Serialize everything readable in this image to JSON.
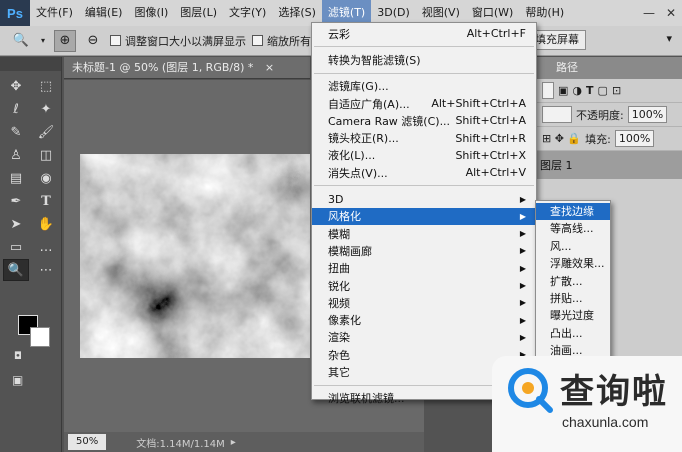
{
  "app": {
    "logo": "Ps"
  },
  "menubar": {
    "items": [
      "文件(F)",
      "编辑(E)",
      "图像(I)",
      "图层(L)",
      "文字(Y)",
      "选择(S)",
      "滤镜(T)",
      "3D(D)",
      "视图(V)",
      "窗口(W)",
      "帮助(H)"
    ],
    "active": "滤镜(T)"
  },
  "options": {
    "resize_windows": "调整窗口大小以满屏显示",
    "zoom_all": "缩放所有",
    "fill_screen": "填充屏幕"
  },
  "document": {
    "tab_title": "未标题-1 @ 50% (图层 1, RGB/8) *",
    "zoom": "50%",
    "doc_size": "文档:1.14M/1.14M"
  },
  "right_panel": {
    "tab_paths": "路径",
    "opacity_label": "不透明度:",
    "opacity_value": "100%",
    "fill_label": "填充:",
    "fill_value": "100%",
    "layer_name": "图层 1"
  },
  "filter_menu": {
    "items": [
      {
        "label": "云彩",
        "shortcut": "Alt+Ctrl+F"
      },
      {
        "label": "转换为智能滤镜(S)",
        "shortcut": ""
      },
      {
        "label": "滤镜库(G)...",
        "shortcut": ""
      },
      {
        "label": "自适应广角(A)...",
        "shortcut": "Alt+Shift+Ctrl+A"
      },
      {
        "label": "Camera Raw 滤镜(C)...",
        "shortcut": "Shift+Ctrl+A"
      },
      {
        "label": "镜头校正(R)...",
        "shortcut": "Shift+Ctrl+R"
      },
      {
        "label": "液化(L)...",
        "shortcut": "Shift+Ctrl+X"
      },
      {
        "label": "消失点(V)...",
        "shortcut": "Alt+Ctrl+V"
      },
      {
        "label": "3D",
        "shortcut": ""
      },
      {
        "label": "风格化",
        "shortcut": ""
      },
      {
        "label": "模糊",
        "shortcut": ""
      },
      {
        "label": "模糊画廊",
        "shortcut": ""
      },
      {
        "label": "扭曲",
        "shortcut": ""
      },
      {
        "label": "锐化",
        "shortcut": ""
      },
      {
        "label": "视频",
        "shortcut": ""
      },
      {
        "label": "像素化",
        "shortcut": ""
      },
      {
        "label": "渲染",
        "shortcut": ""
      },
      {
        "label": "杂色",
        "shortcut": ""
      },
      {
        "label": "其它",
        "shortcut": ""
      },
      {
        "label": "浏览联机滤镜...",
        "shortcut": ""
      }
    ]
  },
  "stylize_submenu": {
    "items": [
      "查找边缘",
      "等高线...",
      "风...",
      "浮雕效果...",
      "扩散...",
      "拼贴...",
      "曝光过度",
      "凸出...",
      "油画..."
    ]
  },
  "watermark": {
    "text": "查询啦",
    "url": "chaxunla.com"
  },
  "colors": {
    "highlight": "#1f6bc4",
    "menu_bg": "#f1f1f1",
    "ps_blue": "#4fb0ff"
  }
}
